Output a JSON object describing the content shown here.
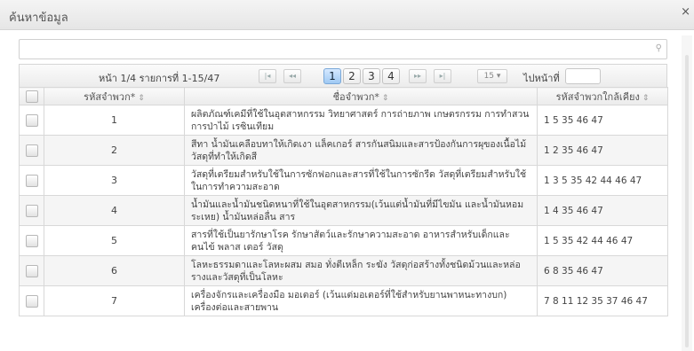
{
  "dialog": {
    "title": "ค้นหาข้อมูล",
    "close": "×"
  },
  "search": {
    "value": "",
    "placeholder": ""
  },
  "pager": {
    "info": "หน้า 1/4 รายการที่ 1-15/47",
    "first": "|◂",
    "prev": "◂◂",
    "pages": [
      "1",
      "2",
      "3",
      "4"
    ],
    "active_page": "1",
    "next": "▸▸",
    "last": "▸|",
    "page_size": "15 ▾",
    "goto_label": "ไปหน้าที่",
    "goto_value": ""
  },
  "table": {
    "headers": [
      "",
      "รหัสจำพวก*",
      "ชื่อจำพวก*",
      "รหัสจำพวกใกล้เคียง"
    ],
    "sort_icon": "⇕",
    "rows": [
      {
        "code": "1",
        "name": "ผลิตภัณฑ์เคมีที่ใช้ในอุตสาหกรรม วิทยาศาสตร์ การถ่ายภาพ เกษตรกรรม การทำสวน การป่าไม้ เรซินเทียม",
        "related": "1 5 35 46 47"
      },
      {
        "code": "2",
        "name": "สีทา น้ำมันเคลือบทาให้เกิดเงา แล็คเกอร์ สารกันสนิมและสารป้องกันการผุของเนื้อไม้วัสดุที่ทำให้เกิดสี",
        "related": "1 2 35 46 47"
      },
      {
        "code": "3",
        "name": "วัสดุที่เตรียมสำหรับใช้ในการซักฟอกและสารที่ใช้ในการซักรีด วัสดุที่เตรียมสำหรับใช้ในการทำความสะอาด",
        "related": "1 3 5 35 42 44 46 47"
      },
      {
        "code": "4",
        "name": "น้ำมันและน้ำมันชนิดหนาที่ใช้ในอุตสาหกรรม(เว้นแต่น้ำมันที่มีไขมัน และน้ำมันหอมระเหย) น้ำมันหล่อลื่น สาร",
        "related": "1 4 35 46 47"
      },
      {
        "code": "5",
        "name": "สารที่ใช้เป็นยารักษาโรค รักษาสัตว์และรักษาความสะอาด อาหารสำหรับเด็กและคนไข้ พลาส เตอร์ วัสดุ",
        "related": "1 5 35 42 44 46 47"
      },
      {
        "code": "6",
        "name": "โลหะธรรมดาและโลหะผสม สมอ ทั่งตีเหล็ก ระฆัง วัสดุก่อสร้างทั้งชนิดม้วนและหล่อรางและวัสดุที่เป็นโลหะ",
        "related": "6 8 35 46 47"
      },
      {
        "code": "7",
        "name": "เครื่องจักรและเครื่องมือ มอเตอร์ (เว้นแต่มอเตอร์ที่ใช้สำหรับยานพาหนะทางบก) เครื่องต่อและสายพาน",
        "related": "7 8 11 12 35 37 46 47"
      }
    ]
  }
}
